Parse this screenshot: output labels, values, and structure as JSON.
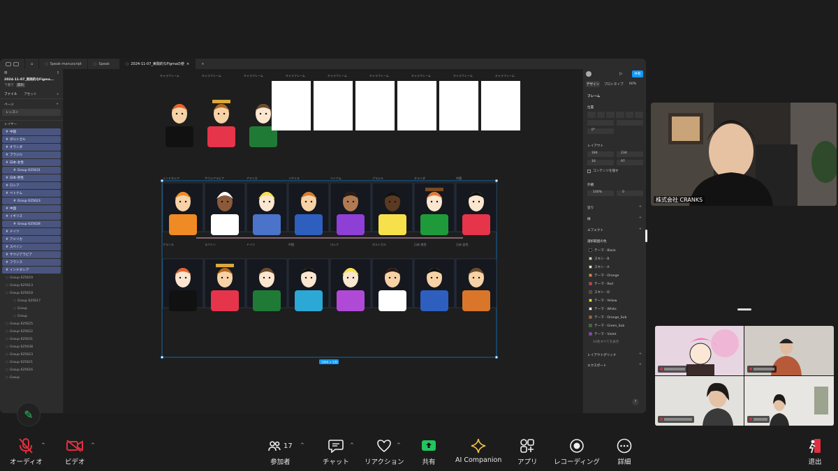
{
  "figma": {
    "tabs": [
      {
        "label": "",
        "icon": "home-icon"
      },
      {
        "label": "Speak-manuscript",
        "icon": "figjam-icon"
      },
      {
        "label": "Speak",
        "icon": "file-icon"
      },
      {
        "label": "2024-11-07_実践的なFigmaの使",
        "icon": "file-icon",
        "active": true
      }
    ],
    "add_tab": "+",
    "file_title": "2024-11-07_実践的なFigma...",
    "file_sub": "下書き",
    "file_badge": "無料",
    "left_tabs": [
      "ファイル",
      "アセット"
    ],
    "pages_label": "ページ",
    "page_item": "レッスン",
    "layers_label": "レイヤー",
    "layers": [
      {
        "name": "中国",
        "type": "sel"
      },
      {
        "name": "ポルトガル",
        "type": "sel"
      },
      {
        "name": "オランダ",
        "type": "sel"
      },
      {
        "name": "ブラジル",
        "type": "sel"
      },
      {
        "name": "日本-女性",
        "type": "sel"
      },
      {
        "name": "Group 625631",
        "type": "child"
      },
      {
        "name": "日本-男性",
        "type": "sel"
      },
      {
        "name": "ロシア",
        "type": "sel"
      },
      {
        "name": "ベトナム",
        "type": "sel"
      },
      {
        "name": "Group 625623",
        "type": "child"
      },
      {
        "name": "中国",
        "type": "sel"
      },
      {
        "name": "イギリス",
        "type": "sel"
      },
      {
        "name": "Group 625628",
        "type": "child"
      },
      {
        "name": "ドイツ",
        "type": "sel"
      },
      {
        "name": "アメリカ",
        "type": "sel"
      },
      {
        "name": "スペイン",
        "type": "sel"
      },
      {
        "name": "サウジアラビア",
        "type": "sel"
      },
      {
        "name": "フランス",
        "type": "sel"
      },
      {
        "name": "インドネシア",
        "type": "sel"
      },
      {
        "name": "Group 625619",
        "type": "plain"
      },
      {
        "name": "Group 625613",
        "type": "plain"
      },
      {
        "name": "Group 625618",
        "type": "plain"
      },
      {
        "name": "Group 625617",
        "type": "plainchild"
      },
      {
        "name": "Group",
        "type": "plainchild"
      },
      {
        "name": "Group",
        "type": "plainchild"
      },
      {
        "name": "Group 625625",
        "type": "plain"
      },
      {
        "name": "Group 625622",
        "type": "plain"
      },
      {
        "name": "Group 625631",
        "type": "plain"
      },
      {
        "name": "Group 625638",
        "type": "plain"
      },
      {
        "name": "Group 625623",
        "type": "plain"
      },
      {
        "name": "Group 625621",
        "type": "plain"
      },
      {
        "name": "Group 625616",
        "type": "plain"
      },
      {
        "name": "Group",
        "type": "plain"
      }
    ],
    "canvas": {
      "frame_label": "キャラフレーム",
      "row1_labels": [
        "インドネシア",
        "サウジアラビア",
        "アメリカ",
        "イギリス",
        "ベトナム",
        "ブラジル",
        "オランダ",
        "中国"
      ],
      "row2_labels": [
        "フランス",
        "スペイン",
        "ドイツ",
        "中国",
        "ロシア",
        "ポルトガル",
        "日本-男性",
        "日本-女性"
      ],
      "size_badge": "1064 × 535"
    },
    "right": {
      "share": "共有",
      "tabs": [
        "デザイン",
        "プロトタイプ"
      ],
      "zoom": "60%",
      "frame_label": "フレーム",
      "position_label": "位置",
      "x_val": "0°",
      "layout_label": "レイアウト",
      "w_val": "184",
      "h_val": "234",
      "pad1": "16",
      "pad2": "97",
      "clip_label": "コンテンツを隠す",
      "appearance_label": "外観",
      "opacity": "100%",
      "radius": "0",
      "fill_label": "塗り",
      "stroke_label": "線",
      "effects_label": "エフェクト",
      "selection_colors_label": "選択範囲の色",
      "colors": [
        {
          "name": "テーマ - Black",
          "hex": "#111111"
        },
        {
          "name": "スキン - B",
          "hex": "#f6d2a6"
        },
        {
          "name": "スキン - A",
          "hex": "#fbe6cf"
        },
        {
          "name": "テーマ - Orange",
          "hex": "#f08a24"
        },
        {
          "name": "テーマ - Red",
          "hex": "#e6344a"
        },
        {
          "name": "スキン - D",
          "hex": "#6b3a22"
        },
        {
          "name": "テーマ - Yellow",
          "hex": "#f7e14b"
        },
        {
          "name": "テーマ - White",
          "hex": "#ffffff"
        },
        {
          "name": "テーマ - Orange_Sub",
          "hex": "#b5651d"
        },
        {
          "name": "テーマ - Green_Sub",
          "hex": "#1f7a36"
        },
        {
          "name": "テーマ - Violet",
          "hex": "#8e3fd6"
        }
      ],
      "more_colors": "16色すべてを表示",
      "layout_grid_label": "レイアウトグリッド",
      "export_label": "エクスポート"
    }
  },
  "meeting": {
    "main_speaker_name": "株式会社 CRANKS",
    "bottom_bar": [
      {
        "label": "オーディオ",
        "icon": "mic-muted-icon"
      },
      {
        "label": "ビデオ",
        "icon": "video-off-icon"
      },
      {
        "label": "参加者",
        "icon": "participants-icon",
        "count": "17"
      },
      {
        "label": "チャット",
        "icon": "chat-icon"
      },
      {
        "label": "リアクション",
        "icon": "heart-icon"
      },
      {
        "label": "共有",
        "icon": "share-screen-icon"
      },
      {
        "label": "AI Companion",
        "icon": "sparkle-icon"
      },
      {
        "label": "アプリ",
        "icon": "apps-icon"
      },
      {
        "label": "レコーディング",
        "icon": "record-icon"
      },
      {
        "label": "詳細",
        "icon": "more-icon"
      },
      {
        "label": "退出",
        "icon": "leave-icon"
      }
    ],
    "accent_green": "#22c55e",
    "muted_red": "#e02f3f"
  }
}
